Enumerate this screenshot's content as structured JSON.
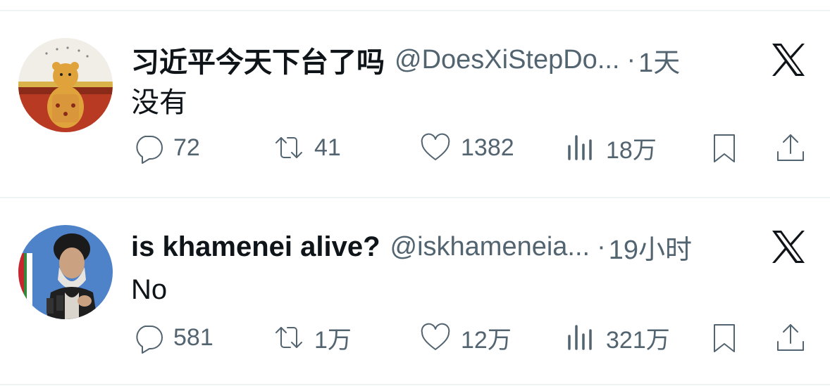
{
  "tweets": [
    {
      "display_name": "习近平今天下台了吗",
      "handle": "@DoesXiStepDo...",
      "separator": "·",
      "time": "1天",
      "text": "没有",
      "avatar_icon": "winnie-the-pooh-avatar",
      "actions": {
        "replies": "72",
        "retweets": "41",
        "likes": "1382",
        "views": "18万"
      }
    },
    {
      "display_name": "is khamenei alive?",
      "handle": "@iskhameneia...",
      "separator": "·",
      "time": "19小时",
      "text": "No",
      "avatar_icon": "khamenei-avatar",
      "actions": {
        "replies": "581",
        "retweets": "1万",
        "likes": "12万",
        "views": "321万"
      }
    }
  ],
  "icons": {
    "platform": "x-logo-icon",
    "reply": "reply-icon",
    "retweet": "retweet-icon",
    "like": "like-icon",
    "views": "views-icon",
    "bookmark": "bookmark-icon",
    "share": "share-icon"
  },
  "colors": {
    "text": "#0f1419",
    "secondary": "#536471",
    "divider": "#eff3f4"
  }
}
